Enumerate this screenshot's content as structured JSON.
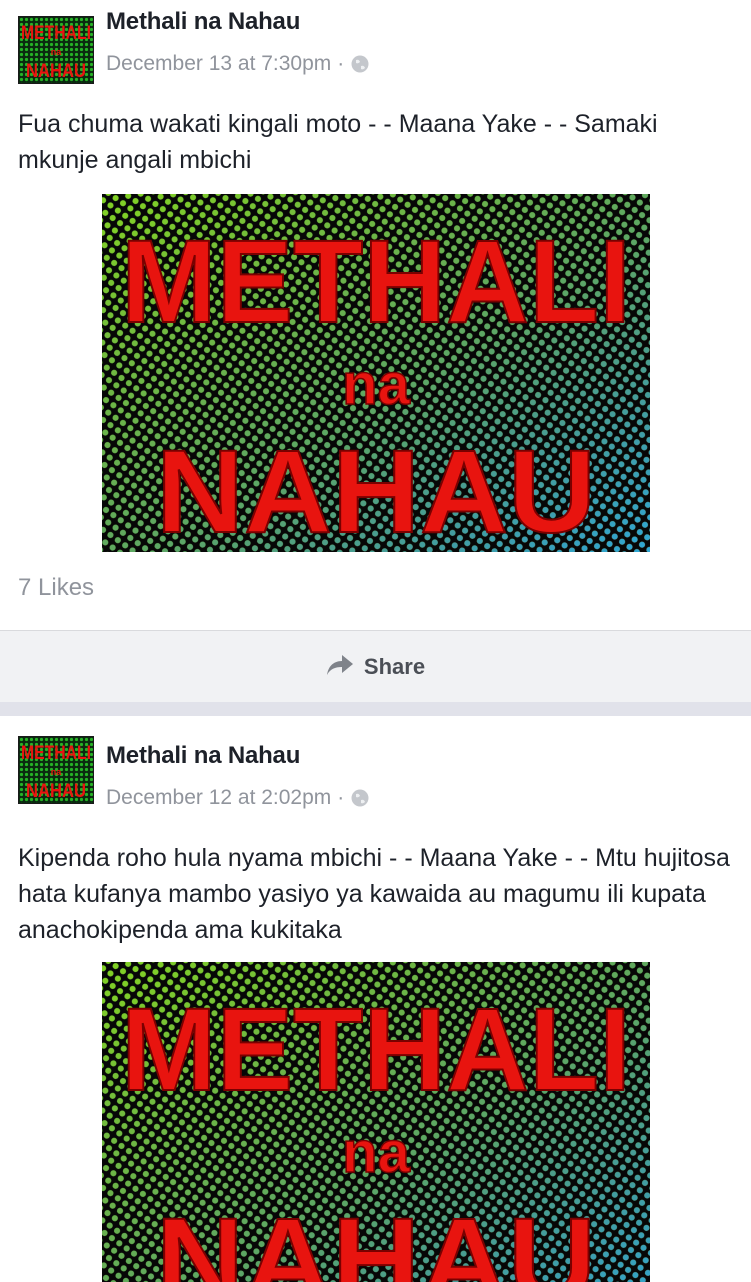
{
  "colors": {
    "brand_red": "#e8140f",
    "brand_green": "#2bd42b",
    "brand_blue": "#2fa8d6",
    "meta_gray": "#90949c"
  },
  "posts": [
    {
      "page_name": "Methali na Nahau",
      "timestamp": "December 13 at 7:30pm",
      "separator": "·",
      "privacy_icon": "globe-icon",
      "text": "Fua chuma wakati kingali moto - - Maana Yake - - Samaki mkunje angali mbichi",
      "image": {
        "line1": "METHALI",
        "line2": "na",
        "line3": "NAHAU"
      },
      "likes": "7 Likes",
      "share_label": "Share"
    },
    {
      "page_name": "Methali na Nahau",
      "timestamp": "December 12 at 2:02pm",
      "separator": "·",
      "privacy_icon": "globe-icon",
      "text": "Kipenda roho hula nyama mbichi - - Maana Yake - - Mtu hujitosa hata kufanya mambo yasiyo ya kawaida au magumu ili kupata anachokipenda ama kukitaka",
      "image": {
        "line1": "METHALI",
        "line2": "na",
        "line3": "NAHAU"
      }
    }
  ]
}
